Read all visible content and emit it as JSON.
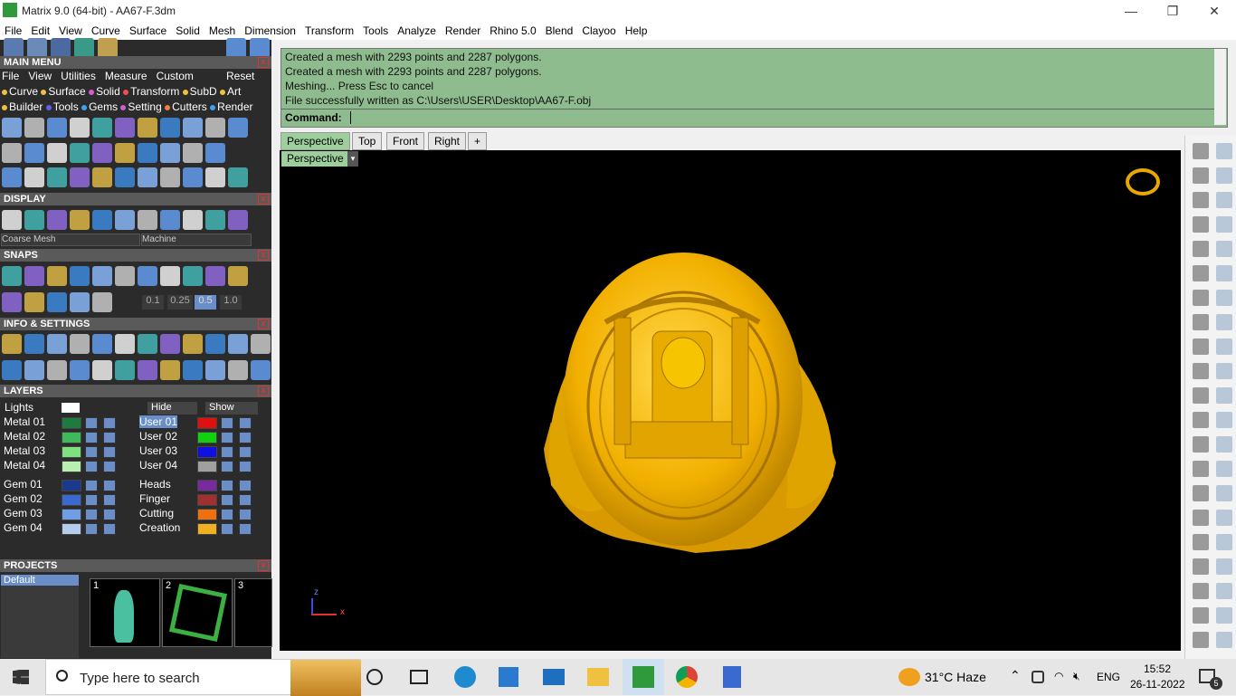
{
  "window": {
    "title": "Matrix 9.0 (64-bit) - AA67-F.3dm"
  },
  "menubar": [
    "File",
    "Edit",
    "View",
    "Curve",
    "Surface",
    "Solid",
    "Mesh",
    "Dimension",
    "Transform",
    "Tools",
    "Analyze",
    "Render",
    "Rhino 5.0",
    "Blend",
    "Clayoo",
    "Help"
  ],
  "main_menu": {
    "title": "MAIN MENU",
    "row1": [
      "File",
      "View",
      "Utilities",
      "Measure",
      "Custom"
    ],
    "reset": "Reset",
    "row2": [
      "Curve",
      "Surface",
      "Solid",
      "Transform",
      "SubD",
      "Art"
    ],
    "row3": [
      "Builder",
      "Tools",
      "Gems",
      "Setting",
      "Cutters",
      "Render"
    ]
  },
  "display": {
    "title": "DISPLAY",
    "dropdown1": "Coarse Mesh",
    "dropdown2": "Machine"
  },
  "snaps": {
    "title": "SNAPS",
    "values": [
      "0.1",
      "0.25",
      "0.5",
      "1.0"
    ]
  },
  "info": {
    "title": "INFO & SETTINGS"
  },
  "layers": {
    "title": "LAYERS",
    "lights": "Lights",
    "hide": "Hide",
    "show": "Show",
    "left": [
      {
        "name": "Metal 01",
        "color": "#1f7a3e"
      },
      {
        "name": "Metal 02",
        "color": "#3dbb5a"
      },
      {
        "name": "Metal 03",
        "color": "#7ee07e"
      },
      {
        "name": "Metal 04",
        "color": "#b8f0b0"
      },
      {
        "name": "Gem 01",
        "color": "#1b3a8e"
      },
      {
        "name": "Gem 02",
        "color": "#3a6ad0"
      },
      {
        "name": "Gem 03",
        "color": "#6f9ee6"
      },
      {
        "name": "Gem 04",
        "color": "#b6ccee"
      }
    ],
    "right": [
      {
        "name": "User 01",
        "color": "#e01010"
      },
      {
        "name": "User 02",
        "color": "#10d010"
      },
      {
        "name": "User 03",
        "color": "#1010e0"
      },
      {
        "name": "User 04",
        "color": "#a0a0a0"
      },
      {
        "name": "Heads",
        "color": "#7a2aa0"
      },
      {
        "name": "Finger",
        "color": "#a03030"
      },
      {
        "name": "Cutting",
        "color": "#f07010"
      },
      {
        "name": "Creation",
        "color": "#f0b020"
      }
    ]
  },
  "projects": {
    "title": "PROJECTS",
    "default": "Default",
    "thumbs": [
      "1",
      "2",
      "3"
    ]
  },
  "command": {
    "lines": [
      "Created a mesh with 2293 points and 2287 polygons.",
      "Created a mesh with 2293 points and 2287 polygons.",
      "Meshing... Press Esc to cancel",
      "File successfully written as C:\\Users\\USER\\Desktop\\AA67-F.obj"
    ],
    "prompt": "Command:"
  },
  "viewport": {
    "tabs": [
      "Perspective",
      "Top",
      "Front",
      "Right"
    ],
    "label": "Perspective",
    "axis_z": "z",
    "axis_x": "x"
  },
  "taskbar": {
    "search_placeholder": "Type here to search",
    "weather": "31°C  Haze",
    "lang": "ENG",
    "time": "15:52",
    "date": "26-11-2022",
    "notif": "5"
  },
  "colors": {
    "gold": "#f2b000",
    "panel": "#2b2b2b",
    "cmd": "#8fbc8f",
    "tab_active": "#9ccf9c"
  }
}
